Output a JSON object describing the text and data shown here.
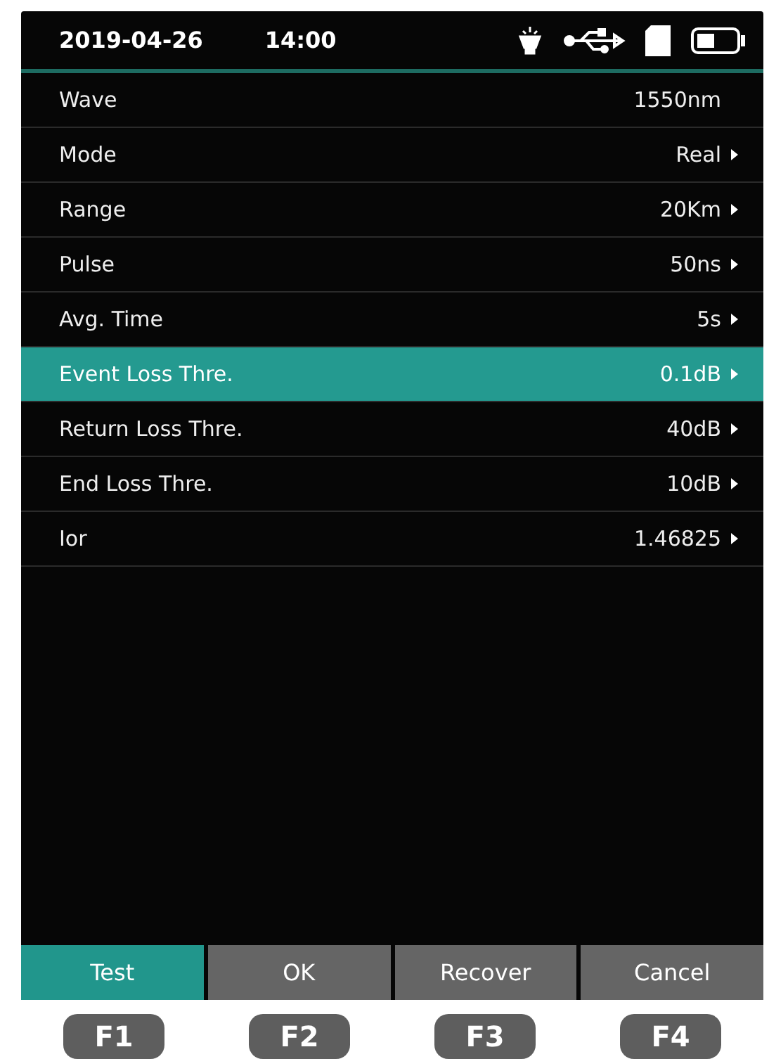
{
  "status_bar": {
    "date": "2019-04-26",
    "time": "14:00"
  },
  "settings": [
    {
      "label": "Wave",
      "value": "1550nm",
      "arrow": false,
      "selected": false
    },
    {
      "label": "Mode",
      "value": "Real",
      "arrow": true,
      "selected": false
    },
    {
      "label": "Range",
      "value": "20Km",
      "arrow": true,
      "selected": false
    },
    {
      "label": "Pulse",
      "value": "50ns",
      "arrow": true,
      "selected": false
    },
    {
      "label": "Avg. Time",
      "value": "5s",
      "arrow": true,
      "selected": false
    },
    {
      "label": "Event Loss Thre.",
      "value": "0.1dB",
      "arrow": true,
      "selected": true
    },
    {
      "label": "Return Loss Thre.",
      "value": "40dB",
      "arrow": true,
      "selected": false
    },
    {
      "label": "End Loss Thre.",
      "value": "10dB",
      "arrow": true,
      "selected": false
    },
    {
      "label": "Ior",
      "value": "1.46825",
      "arrow": true,
      "selected": false
    }
  ],
  "soft_buttons": [
    {
      "label": "Test",
      "selected": true
    },
    {
      "label": "OK",
      "selected": false
    },
    {
      "label": "Recover",
      "selected": false
    },
    {
      "label": "Cancel",
      "selected": false
    }
  ],
  "function_keys": [
    "F1",
    "F2",
    "F3",
    "F4"
  ]
}
